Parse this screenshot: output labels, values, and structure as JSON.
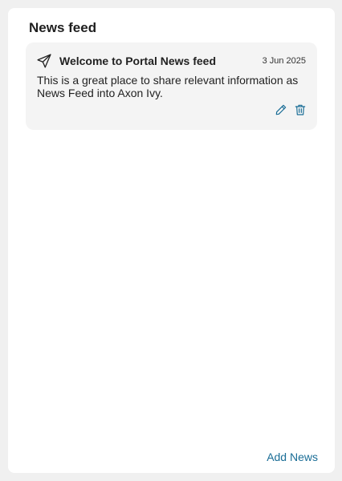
{
  "panel": {
    "title": "News feed"
  },
  "news_items": [
    {
      "icon": "send-icon",
      "title": "Welcome to Portal News feed",
      "date": "3 Jun 2025",
      "body": "This is a great place to share relevant information as News Feed into Axon Ivy.",
      "actions": [
        "edit-icon",
        "delete-icon"
      ]
    }
  ],
  "footer": {
    "add_label": "Add News"
  },
  "colors": {
    "accent": "#1a6d96",
    "card_bg": "#f4f4f4",
    "page_bg": "#f0f0f0"
  }
}
